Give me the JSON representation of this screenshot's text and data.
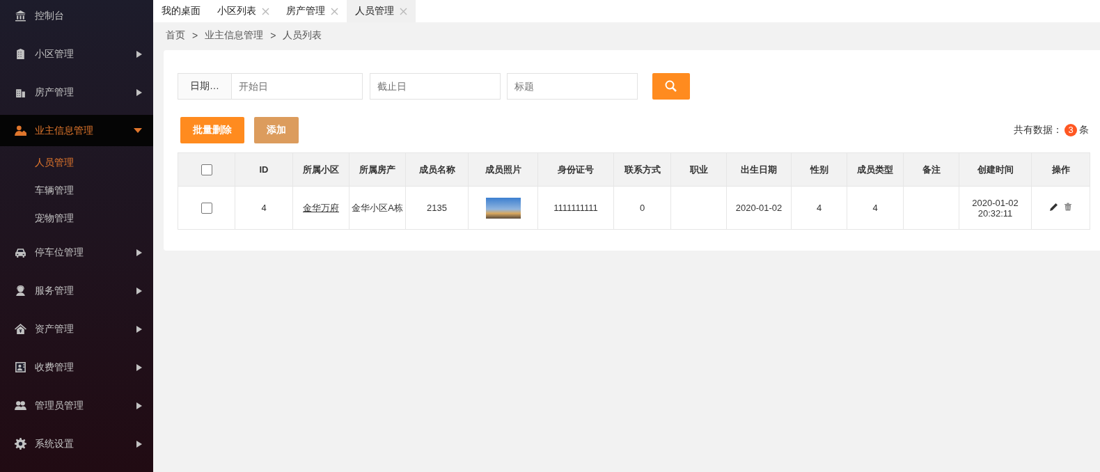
{
  "sidebar": {
    "items": [
      {
        "label": "控制台"
      },
      {
        "label": "小区管理",
        "expanded": false
      },
      {
        "label": "房产管理",
        "expanded": false
      },
      {
        "label": "业主信息管理",
        "expanded": true,
        "children": [
          {
            "label": "人员管理",
            "selected": true
          },
          {
            "label": "车辆管理",
            "selected": false
          },
          {
            "label": "宠物管理",
            "selected": false
          }
        ]
      },
      {
        "label": "停车位管理",
        "expanded": false
      },
      {
        "label": "服务管理",
        "expanded": false
      },
      {
        "label": "资产管理",
        "expanded": false
      },
      {
        "label": "收费管理",
        "expanded": false
      },
      {
        "label": "管理员管理",
        "expanded": false
      },
      {
        "label": "系统设置",
        "expanded": false
      }
    ]
  },
  "tabs": [
    {
      "label": "我的桌面",
      "closable": false,
      "selected": false
    },
    {
      "label": "小区列表",
      "closable": true,
      "selected": false
    },
    {
      "label": "房产管理",
      "closable": true,
      "selected": false
    },
    {
      "label": "人员管理",
      "closable": true,
      "selected": true
    }
  ],
  "breadcrumb": [
    "首页",
    "业主信息管理",
    "人员列表"
  ],
  "breadcrumb_separator": ">",
  "search": {
    "label": "日期…",
    "fields": [
      {
        "placeholder": "开始日"
      },
      {
        "placeholder": "截止日"
      },
      {
        "placeholder": "标题"
      }
    ]
  },
  "buttons": [
    {
      "label": "批量删除",
      "kind": "primary"
    },
    {
      "label": "添加",
      "kind": "secondary"
    }
  ],
  "total": {
    "label": "共有数据：",
    "count": "3",
    "unit": "条"
  },
  "table": {
    "header_checked": false,
    "columns": [
      "ID",
      "所属小区",
      "所属房产",
      "成员名称",
      "成员照片",
      "身份证号",
      "联系方式",
      "职业",
      "出生日期",
      "性别",
      "成员类型",
      "备注",
      "创建时间",
      "操作"
    ],
    "rows": [
      {
        "checked": false,
        "cells": [
          {
            "kind": "text",
            "text": "4"
          },
          {
            "kind": "link",
            "text": "金华万府"
          },
          {
            "kind": "text",
            "text": "金华小区A栋"
          },
          {
            "kind": "text",
            "text": "2135"
          },
          {
            "kind": "photo"
          },
          {
            "kind": "text",
            "text": "1111111111"
          },
          {
            "kind": "text",
            "text": "0"
          },
          {
            "kind": "empty"
          },
          {
            "kind": "text",
            "text": "2020-01-02"
          },
          {
            "kind": "text",
            "text": "4"
          },
          {
            "kind": "text",
            "text": "4"
          },
          {
            "kind": "empty"
          },
          {
            "kind": "lines",
            "lines": [
              "2020-01-02",
              "20:32:11"
            ]
          },
          {
            "kind": "actions"
          }
        ]
      }
    ]
  }
}
